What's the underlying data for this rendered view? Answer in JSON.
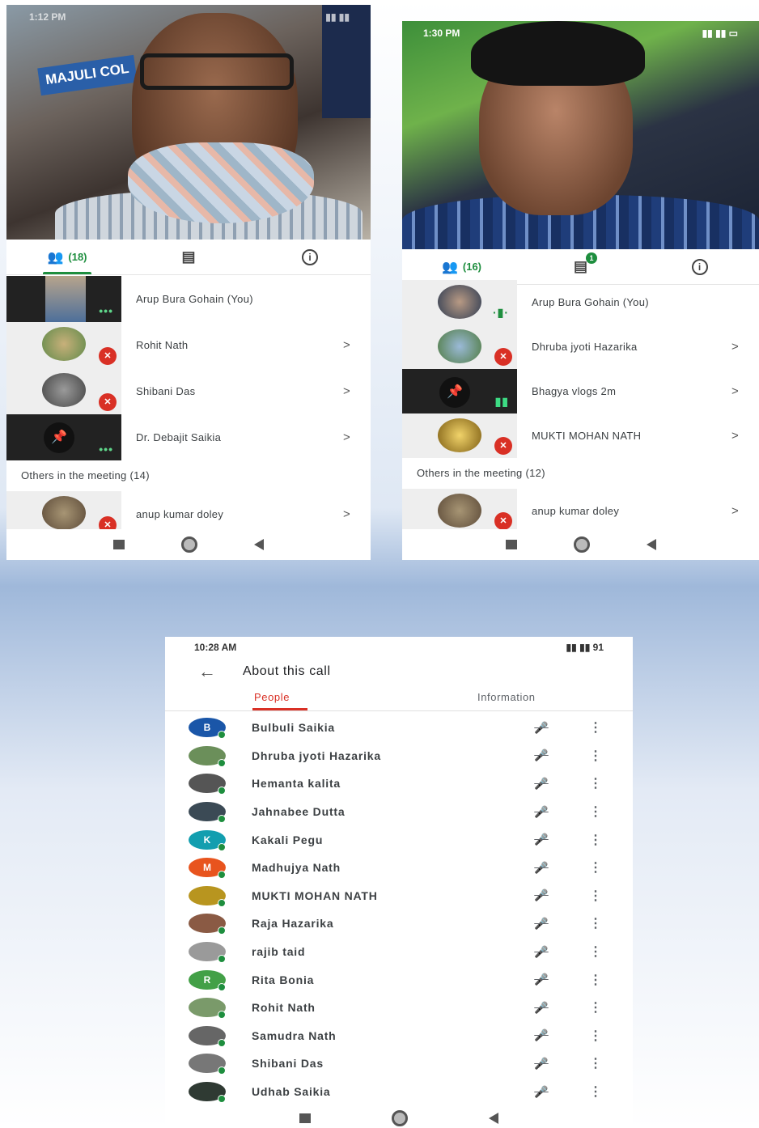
{
  "shot1": {
    "status_time": "1:12 PM",
    "sign_text": "MAJULI COL",
    "participant_count": "(18)",
    "participants": [
      {
        "name": "Arup Bura Gohain (You)",
        "thumb": "video",
        "state": "speaking-dots",
        "chevron": ""
      },
      {
        "name": "Rohit Nath",
        "thumb": "avatar",
        "state": "muted",
        "chevron": ">"
      },
      {
        "name": "Shibani Das",
        "thumb": "avatar",
        "state": "muted",
        "chevron": ">"
      },
      {
        "name": "Dr. Debajit Saikia",
        "thumb": "pinned",
        "state": "speaking-dots",
        "chevron": ">"
      }
    ],
    "others_label": "Others in the meeting (14)",
    "others": [
      {
        "name": "anup kumar doley",
        "chevron": ">"
      }
    ]
  },
  "shot2": {
    "status_time": "1:30 PM",
    "participant_count": "(16)",
    "chat_badge": "1",
    "participants": [
      {
        "name": "Arup Bura Gohain (You)",
        "chevron": ""
      },
      {
        "name": "Dhruba jyoti Hazarika",
        "chevron": ">"
      },
      {
        "name": "Bhagya vlogs 2m",
        "chevron": ">"
      },
      {
        "name": "MUKTI MOHAN NATH",
        "chevron": ">"
      }
    ],
    "others_label": "Others in the meeting (12)",
    "others": [
      {
        "name": "anup kumar doley",
        "chevron": ">"
      }
    ]
  },
  "shot3": {
    "status_time": "10:28 AM",
    "battery": "91",
    "title": "About this call",
    "tabs": [
      "People",
      "Information"
    ],
    "people": [
      {
        "name": "Bulbuli Saikia",
        "initial": "B",
        "color": "#1a56a8"
      },
      {
        "name": "Dhruba jyoti Hazarika",
        "initial": "",
        "color": "#6b8f5a"
      },
      {
        "name": "Hemanta kalita",
        "initial": "",
        "color": "#555555"
      },
      {
        "name": "Jahnabee Dutta",
        "initial": "",
        "color": "#3b4a55"
      },
      {
        "name": "Kakali Pegu",
        "initial": "K",
        "color": "#129eaf"
      },
      {
        "name": "Madhujya Nath",
        "initial": "M",
        "color": "#e8541e"
      },
      {
        "name": "MUKTI MOHAN NATH",
        "initial": "",
        "color": "#b8951f"
      },
      {
        "name": "Raja Hazarika",
        "initial": "",
        "color": "#8a5a44"
      },
      {
        "name": "rajib taid",
        "initial": "",
        "color": "#9a9a9a"
      },
      {
        "name": "Rita Bonia",
        "initial": "R",
        "color": "#43a047"
      },
      {
        "name": "Rohit Nath",
        "initial": "",
        "color": "#7a9a6a"
      },
      {
        "name": "Samudra Nath",
        "initial": "",
        "color": "#666666"
      },
      {
        "name": "Shibani Das",
        "initial": "",
        "color": "#777777"
      },
      {
        "name": "Udhab Saikia",
        "initial": "",
        "color": "#2f3a33"
      }
    ]
  }
}
